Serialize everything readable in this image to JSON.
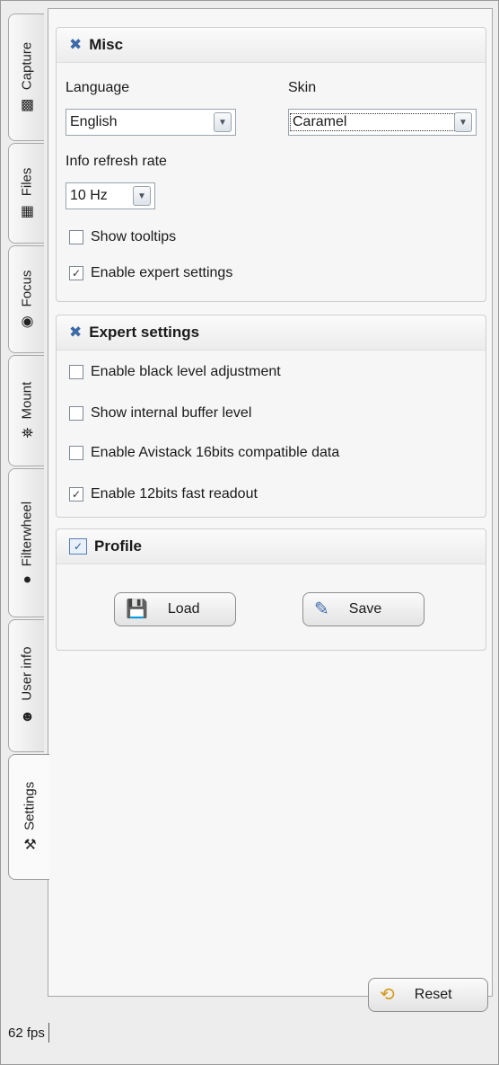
{
  "tabs": [
    {
      "label": "Capture",
      "icon": "camera-icon"
    },
    {
      "label": "Files",
      "icon": "film-icon"
    },
    {
      "label": "Focus",
      "icon": "target-icon"
    },
    {
      "label": "Mount",
      "icon": "telescope-icon"
    },
    {
      "label": "Filterwheel",
      "icon": "filterwheel-icon"
    },
    {
      "label": "User info",
      "icon": "user-icon"
    },
    {
      "label": "Settings",
      "icon": "tools-icon",
      "active": true
    }
  ],
  "misc": {
    "title": "Misc",
    "language_label": "Language",
    "language_value": "English",
    "skin_label": "Skin",
    "skin_value": "Caramel",
    "refresh_label": "Info refresh rate",
    "refresh_value": "10 Hz",
    "show_tooltips": {
      "label": "Show tooltips",
      "checked": false
    },
    "expert_settings": {
      "label": "Enable expert settings",
      "checked": true
    }
  },
  "expert": {
    "title": "Expert settings",
    "options": [
      {
        "label": "Enable black level adjustment",
        "checked": false
      },
      {
        "label": "Show internal buffer level",
        "checked": false
      },
      {
        "label": "Enable Avistack 16bits compatible data",
        "checked": false
      },
      {
        "label": "Enable 12bits fast readout",
        "checked": true
      }
    ]
  },
  "profile": {
    "title": "Profile",
    "load_label": "Load",
    "save_label": "Save"
  },
  "reset_label": "Reset",
  "status": {
    "fps": "62 fps"
  }
}
